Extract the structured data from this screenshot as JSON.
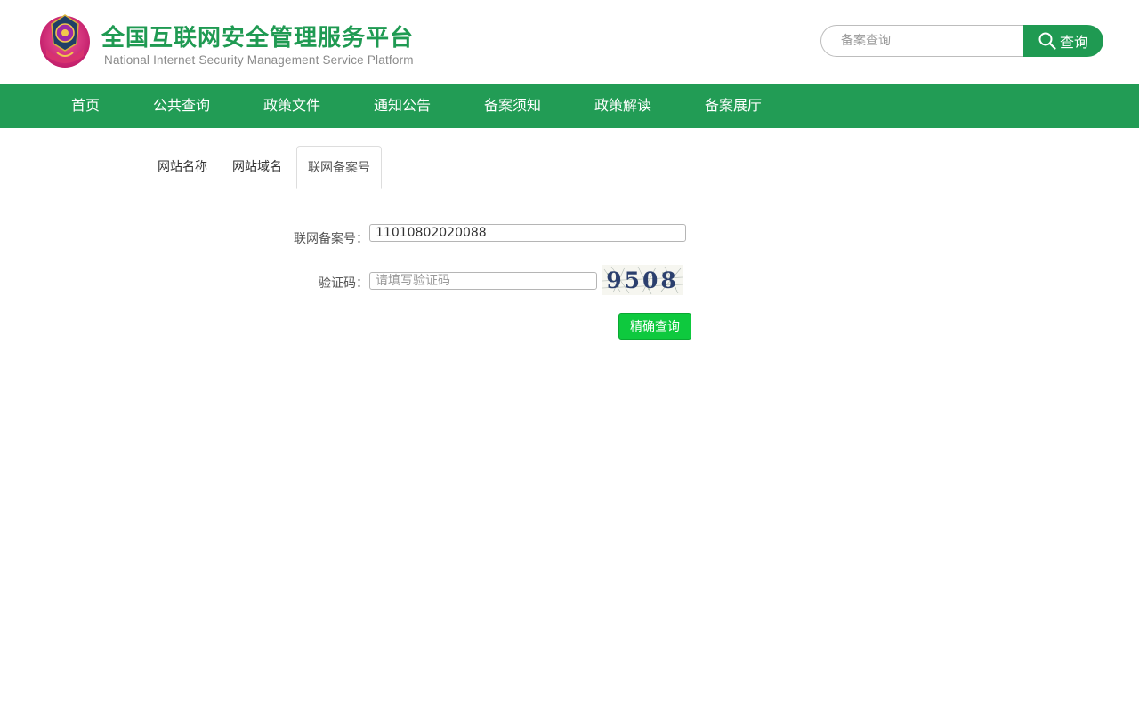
{
  "header": {
    "title": "全国互联网安全管理服务平台",
    "subtitle": "National Internet Security Management Service Platform",
    "emblem_icon": "national-emblem-icon"
  },
  "search": {
    "placeholder": "备案查询",
    "button_label": "查询",
    "icon": "search-icon"
  },
  "nav": {
    "items": [
      "首页",
      "公共查询",
      "政策文件",
      "通知公告",
      "备案须知",
      "政策解读",
      "备案展厅"
    ]
  },
  "tabs": {
    "items": [
      "网站名称",
      "网站域名",
      "联网备案号"
    ],
    "active": "联网备案号"
  },
  "form": {
    "record_label": "联网备案号：",
    "record_value": "11010802020088",
    "captcha_label": "验证码：",
    "captcha_placeholder": "请填写验证码",
    "captcha_text": "9508",
    "submit_label": "精确查询"
  },
  "colors": {
    "brand_green": "#229c55",
    "title_green": "#1f9a52",
    "submit_green": "#0ec93e"
  }
}
